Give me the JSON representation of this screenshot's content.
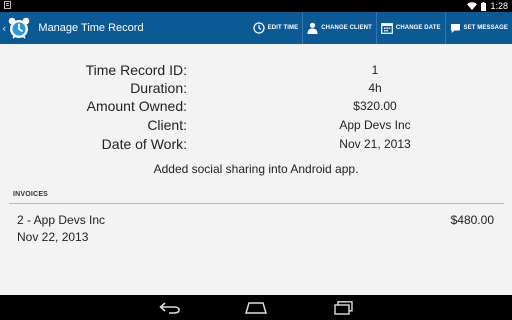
{
  "status_bar": {
    "time": "1:28",
    "left_icon": "notification-icon",
    "icons": [
      "wifi-icon",
      "battery-icon"
    ]
  },
  "action_bar": {
    "up_icon": "chevron-left-icon",
    "app_icon": "alarm-clock-icon",
    "title": "Manage Time Record",
    "color": "#0b5a95",
    "actions": [
      {
        "label": "EDIT TIME",
        "icon": "clock-icon"
      },
      {
        "label": "CHANGE CLIENT",
        "icon": "person-icon"
      },
      {
        "label": "CHANGE DATE",
        "icon": "calendar-icon"
      },
      {
        "label": "SET MESSAGE",
        "icon": "chat-bubble-icon"
      }
    ]
  },
  "record": {
    "fields": [
      {
        "label": "Time Record ID:",
        "value": "1"
      },
      {
        "label": "Duration:",
        "value": "4h"
      },
      {
        "label": "Amount Owned:",
        "value": "$320.00"
      },
      {
        "label": "Client:",
        "value": "App Devs Inc"
      },
      {
        "label": "Date of Work:",
        "value": "Nov 21, 2013"
      }
    ],
    "message": "Added social sharing into Android app."
  },
  "invoices": {
    "header": "INVOICES",
    "items": [
      {
        "title": "2 - App Devs Inc",
        "date": "Nov 22, 2013",
        "amount": "$480.00"
      }
    ]
  },
  "nav_bar": {
    "buttons": [
      "back-icon",
      "home-icon",
      "recent-apps-icon"
    ]
  }
}
